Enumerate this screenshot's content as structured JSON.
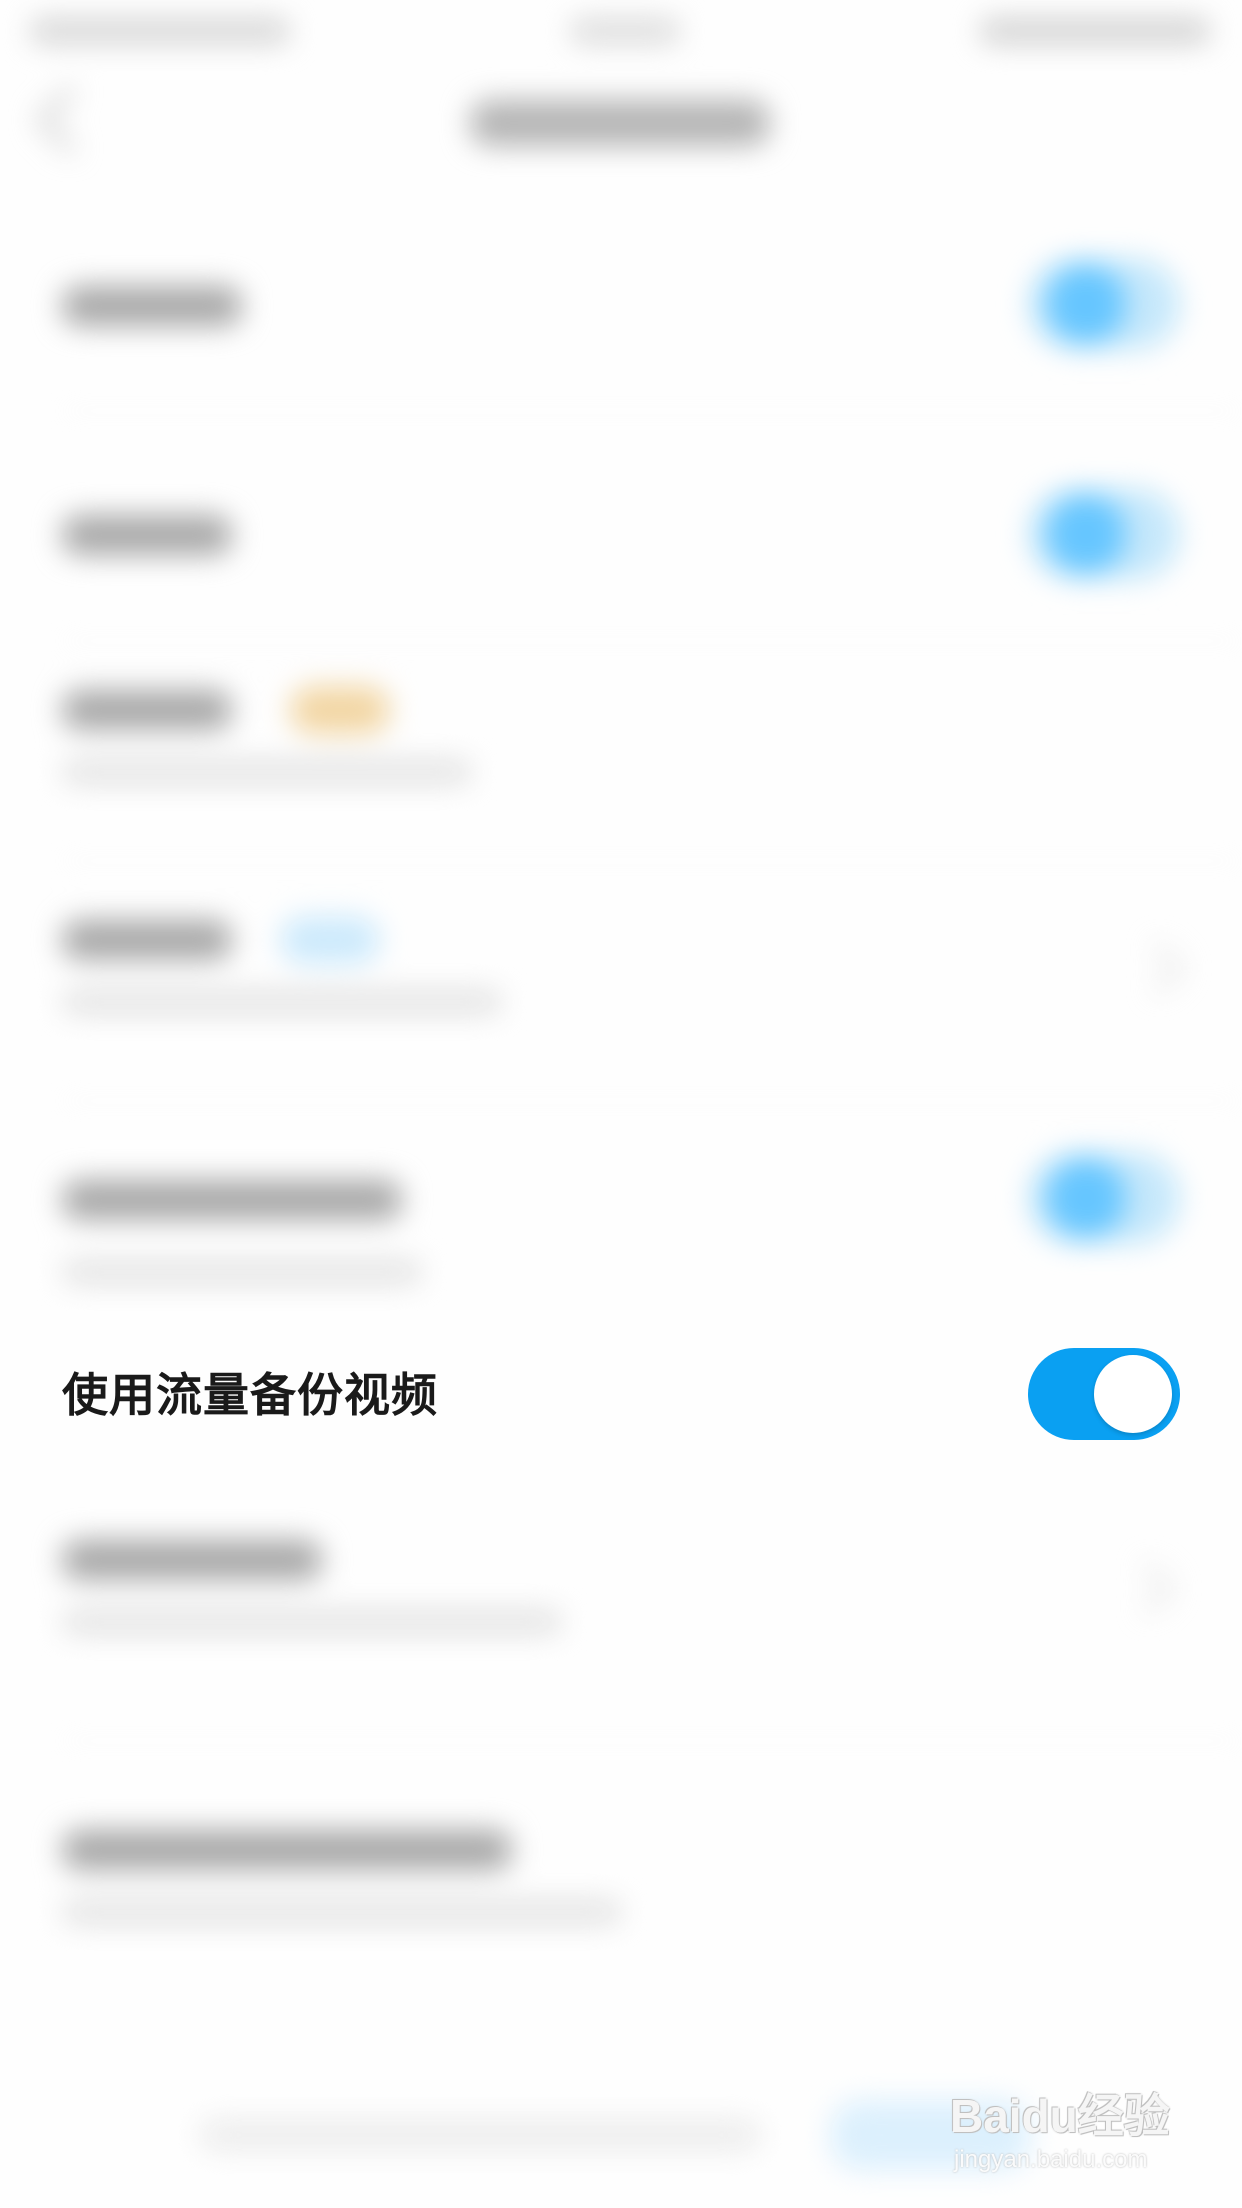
{
  "setting": {
    "label": "使用流量备份视频",
    "enabled": true,
    "toggle_color": "#0aa0f2"
  },
  "watermark": {
    "main": "Baidu经验",
    "sub": "jingyan.baidu.com"
  }
}
